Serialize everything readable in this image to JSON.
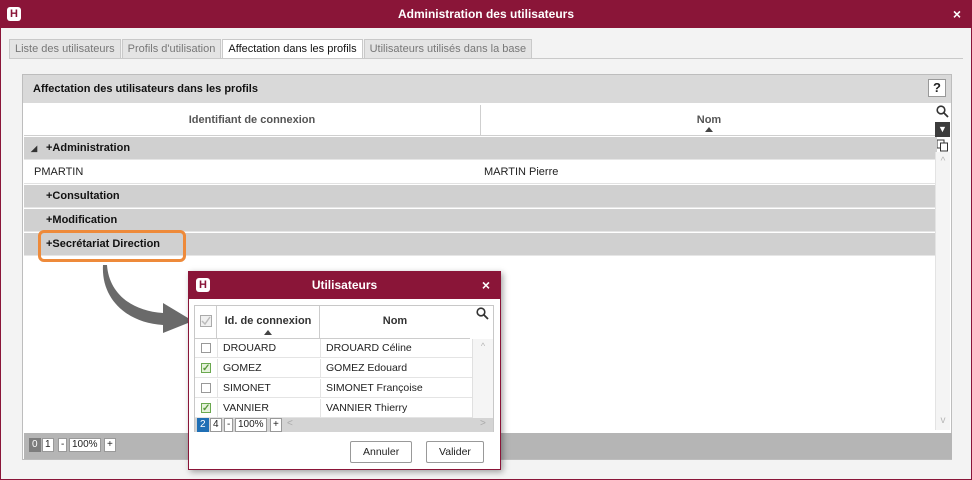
{
  "window": {
    "title": "Administration des utilisateurs",
    "logo": "H",
    "close": "×"
  },
  "tabs": [
    {
      "label": "Liste des utilisateurs"
    },
    {
      "label": "Profils d'utilisation"
    },
    {
      "label": "Affectation dans les profils"
    },
    {
      "label": "Utilisateurs utilisés dans la base"
    }
  ],
  "panel": {
    "title": "Affectation des utilisateurs dans les profils",
    "help": "?",
    "columns": {
      "login": "Identifiant de connexion",
      "name": "Nom"
    },
    "rows": [
      {
        "type": "group",
        "label": "+Administration",
        "expanded": true
      },
      {
        "type": "item",
        "login": "PMARTIN",
        "name": "MARTIN Pierre"
      },
      {
        "type": "group",
        "label": "+Consultation"
      },
      {
        "type": "group",
        "label": "+Modification"
      },
      {
        "type": "group",
        "label": "+Secrétariat Direction"
      }
    ],
    "footer": {
      "p0": "0",
      "p1": "1",
      "minus": "-",
      "zoom": "100%",
      "plus": "+"
    }
  },
  "icons": {
    "search": "search-icon",
    "sort": "sort-desc-icon",
    "copy": "copy-icon",
    "expand": "triangle-expanded-icon"
  },
  "dialog": {
    "title": "Utilisateurs",
    "logo": "H",
    "close": "×",
    "columns": {
      "login": "Id. de connexion",
      "name": "Nom"
    },
    "rows": [
      {
        "checked": false,
        "login": "DROUARD",
        "name": "DROUARD Céline"
      },
      {
        "checked": true,
        "login": "GOMEZ",
        "name": "GOMEZ Edouard"
      },
      {
        "checked": false,
        "login": "SIMONET",
        "name": "SIMONET Françoise"
      },
      {
        "checked": true,
        "login": "VANNIER",
        "name": "VANNIER Thierry"
      }
    ],
    "footer": {
      "p0": "2",
      "p1": "4",
      "minus": "-",
      "zoom": "100%",
      "plus": "+"
    },
    "buttons": {
      "cancel": "Annuler",
      "ok": "Valider"
    }
  },
  "colors": {
    "brand": "#8a1538",
    "highlight": "#ee8a3a",
    "check": "#5a9a3c"
  }
}
